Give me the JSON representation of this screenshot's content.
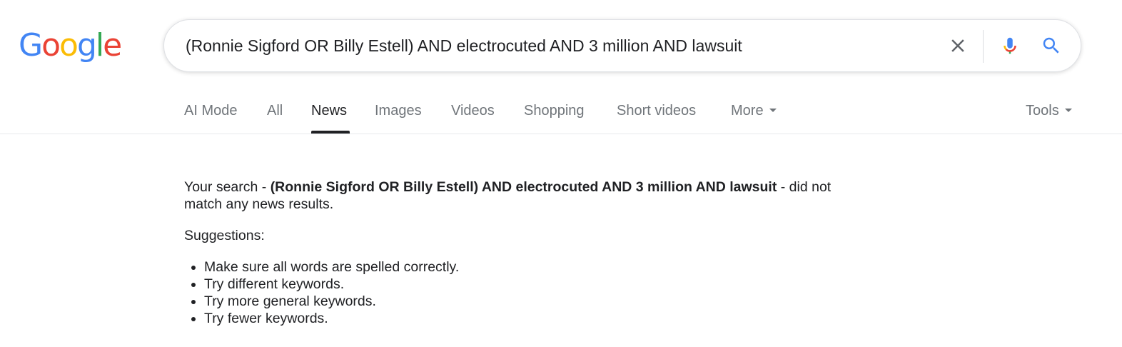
{
  "logo": {
    "text": "Google",
    "colors": [
      "#4285F4",
      "#EA4335",
      "#FBBC05",
      "#4285F4",
      "#34A853",
      "#EA4335"
    ]
  },
  "search": {
    "value": "(Ronnie Sigford OR Billy Estell) AND electrocuted AND 3 million AND lawsuit",
    "clear_icon": "close-icon",
    "mic_icon": "mic-icon",
    "search_icon": "search-icon"
  },
  "tabs": [
    {
      "label": "AI Mode"
    },
    {
      "label": "All"
    },
    {
      "label": "News",
      "active": true
    },
    {
      "label": "Images"
    },
    {
      "label": "Videos"
    },
    {
      "label": "Shopping"
    },
    {
      "label": "Short videos"
    },
    {
      "label": "More"
    }
  ],
  "tools_label": "Tools",
  "message": {
    "prefix": "Your search - ",
    "query": "(Ronnie Sigford OR Billy Estell) AND electrocuted AND 3 million AND lawsuit",
    "suffix": " - did not match any news results."
  },
  "suggestions": {
    "title": "Suggestions:",
    "items": [
      "Make sure all words are spelled correctly.",
      "Try different keywords.",
      "Try more general keywords.",
      "Try fewer keywords."
    ]
  },
  "colors": {
    "text": "#202124",
    "muted": "#70757a",
    "border": "#dfe1e5"
  }
}
